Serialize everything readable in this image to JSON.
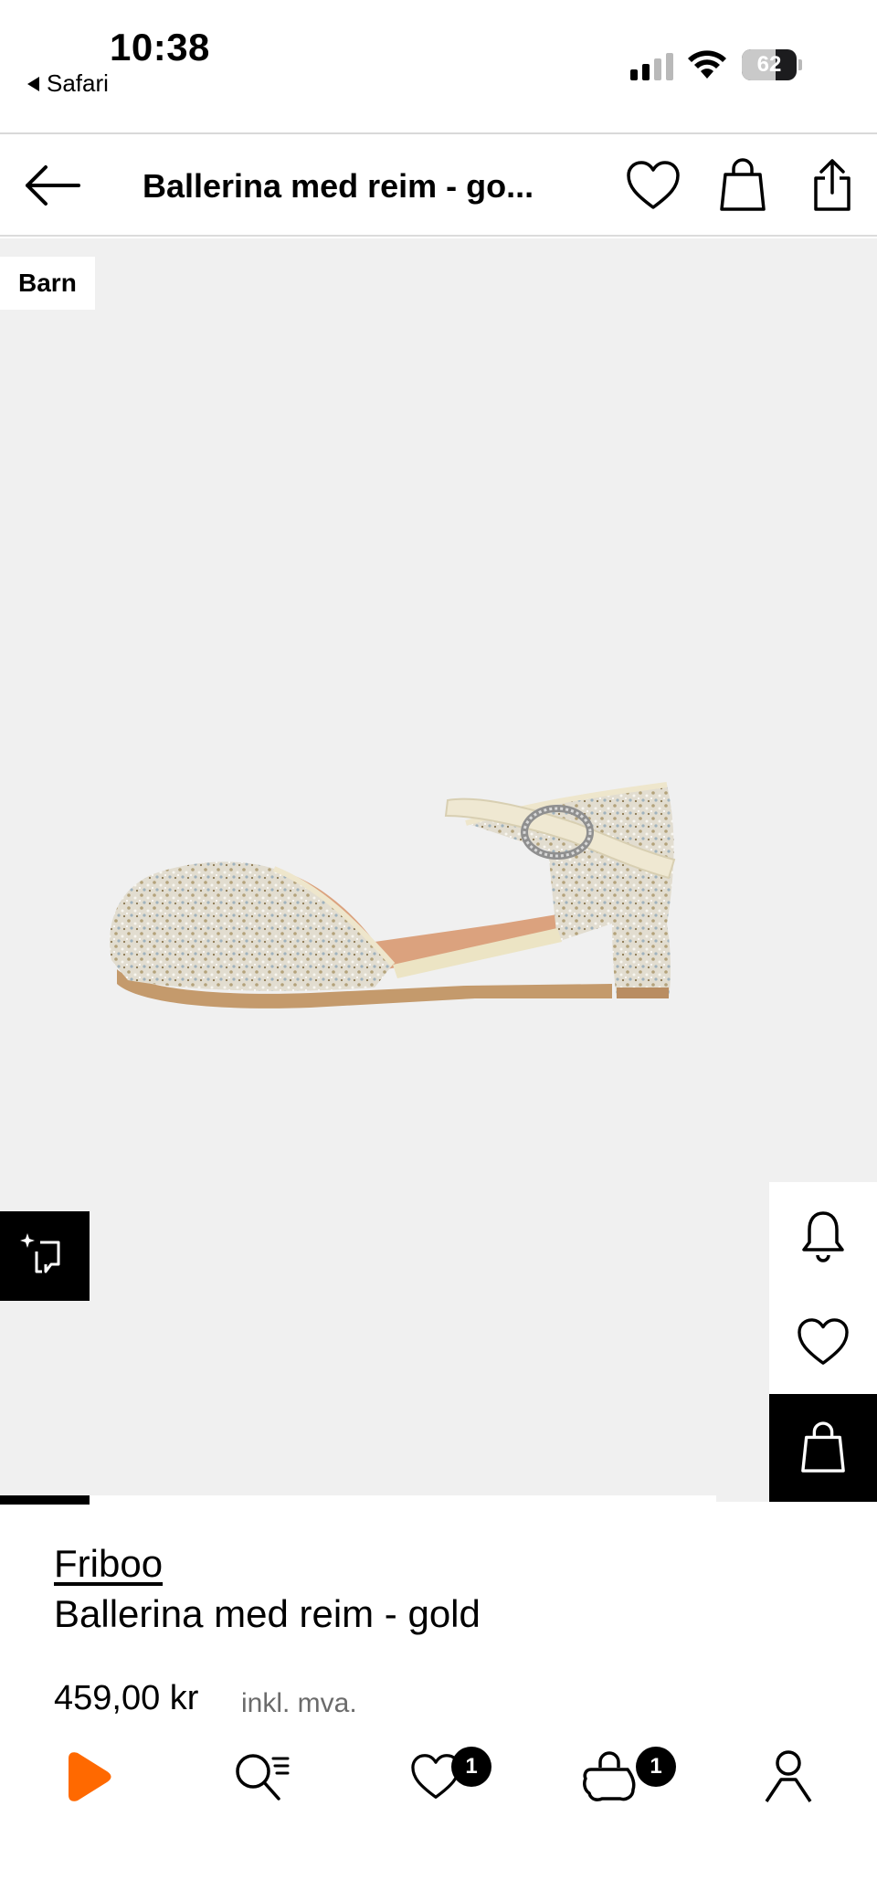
{
  "status_bar": {
    "time": "10:38",
    "back_app": "Safari",
    "battery_level": "62",
    "battery_fraction": 0.62,
    "signal_bars_active": 2,
    "signal_bars_total": 4
  },
  "header": {
    "title": "Ballerina med reim - go...",
    "icons": [
      "back-arrow-icon",
      "heart-icon",
      "shopping-bag-icon",
      "share-icon"
    ]
  },
  "product": {
    "tag": "Barn",
    "brand": "Friboo",
    "name": "Ballerina med reim - gold",
    "price": "459,00 kr",
    "vat_note": "inkl. mva.",
    "image_gallery_progress": 0.125
  },
  "side_actions": [
    "bell-icon",
    "heart-icon",
    "shopping-bag-icon"
  ],
  "bottom_nav": {
    "items": [
      {
        "name": "home",
        "icon": "zalando-logo-icon"
      },
      {
        "name": "search",
        "icon": "search-list-icon"
      },
      {
        "name": "wishlist",
        "icon": "heart-icon",
        "badge": "1"
      },
      {
        "name": "bag",
        "icon": "shopping-bag-icon",
        "badge": "1"
      },
      {
        "name": "account",
        "icon": "person-icon"
      }
    ]
  },
  "colors": {
    "accent": "#ff6900",
    "image_background": "#f0f0f0",
    "text": "#000000",
    "muted_text": "#6b6b6b"
  }
}
